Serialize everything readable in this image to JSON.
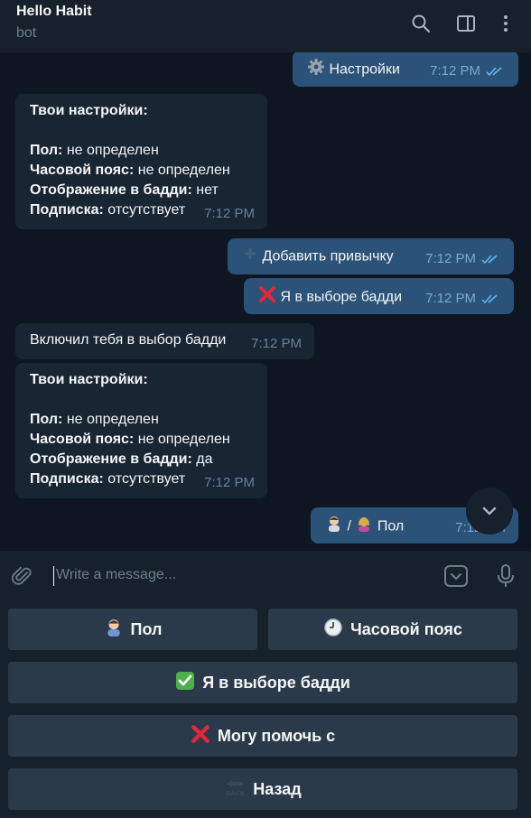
{
  "header": {
    "title": "Hello Habit",
    "subtitle": "bot"
  },
  "messages": [
    {
      "dir": "out",
      "emoji": "gear-emoji",
      "text": "Настройки",
      "time": "7:12 PM"
    },
    {
      "dir": "in",
      "heading": "Твои настройки:",
      "rows": [
        {
          "key": "Пол:",
          "value": " не определен"
        },
        {
          "key": "Часовой пояс:",
          "value": " не определен"
        },
        {
          "key": "Отображение в бадди:",
          "value": " нет"
        },
        {
          "key": "Подписка:",
          "value": " отсутствует"
        }
      ],
      "time": "7:12 PM"
    },
    {
      "dir": "out",
      "emoji": "plus-emoji",
      "text": "Добавить привычку",
      "time": "7:12 PM"
    },
    {
      "dir": "out",
      "emoji": "cross-emoji",
      "text": "Я в выборе бадди",
      "time": "7:12 PM"
    },
    {
      "dir": "in",
      "text": "Включил тебя в выбор бадди",
      "time": "7:12 PM"
    },
    {
      "dir": "in",
      "heading": "Твои настройки:",
      "rows": [
        {
          "key": "Пол:",
          "value": " не определен"
        },
        {
          "key": "Часовой пояс:",
          "value": " не определен"
        },
        {
          "key": "Отображение в бадди:",
          "value": " да"
        },
        {
          "key": "Подписка:",
          "value": " отсутствует"
        }
      ],
      "time": "7:12 PM"
    },
    {
      "dir": "out",
      "emoji": "man-woman-emoji",
      "text": "/",
      "text2": "Пол",
      "time": "7:12 PM"
    }
  ],
  "input": {
    "placeholder": "Write a message..."
  },
  "keyboard": {
    "gender": "Пол",
    "timezone": "Часовой пояс",
    "buddy": "Я в выборе бадди",
    "can_help": "Могу помочь с",
    "back": "Назад",
    "back_icon_text": "BACK"
  },
  "colors": {
    "background": "#0e1621",
    "header": "#17212b",
    "incoming": "#182533",
    "outgoing": "#2b5278",
    "keyboard_button": "#2b3a4a",
    "accent": "#5eb5f7"
  }
}
